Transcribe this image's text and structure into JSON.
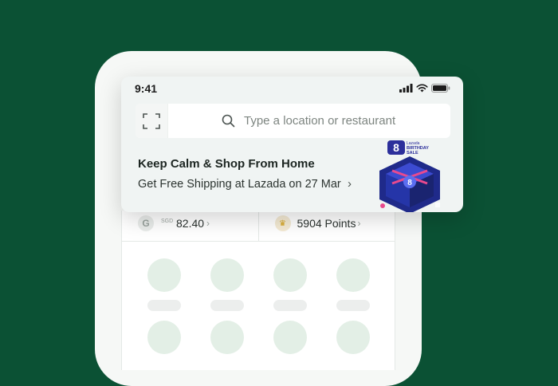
{
  "status_bar": {
    "time": "9:41"
  },
  "search": {
    "placeholder": "Type a location or restaurant"
  },
  "promo": {
    "title": "Keep Calm & Shop From Home",
    "subtitle": "Get Free Shipping at Lazada on 27 Mar",
    "badge_brand": "Lazada",
    "badge_text_1": "BIRTHDAY",
    "badge_text_2": "SALE",
    "badge_number": "8"
  },
  "wallet": {
    "currency": "SGD",
    "balance": "82.40",
    "points": "5904 Points",
    "grabpay_icon_letter": "G"
  },
  "colors": {
    "background": "#0b5134",
    "accent_green": "#00b14f",
    "placeholder_circle": "#e3efe6"
  }
}
